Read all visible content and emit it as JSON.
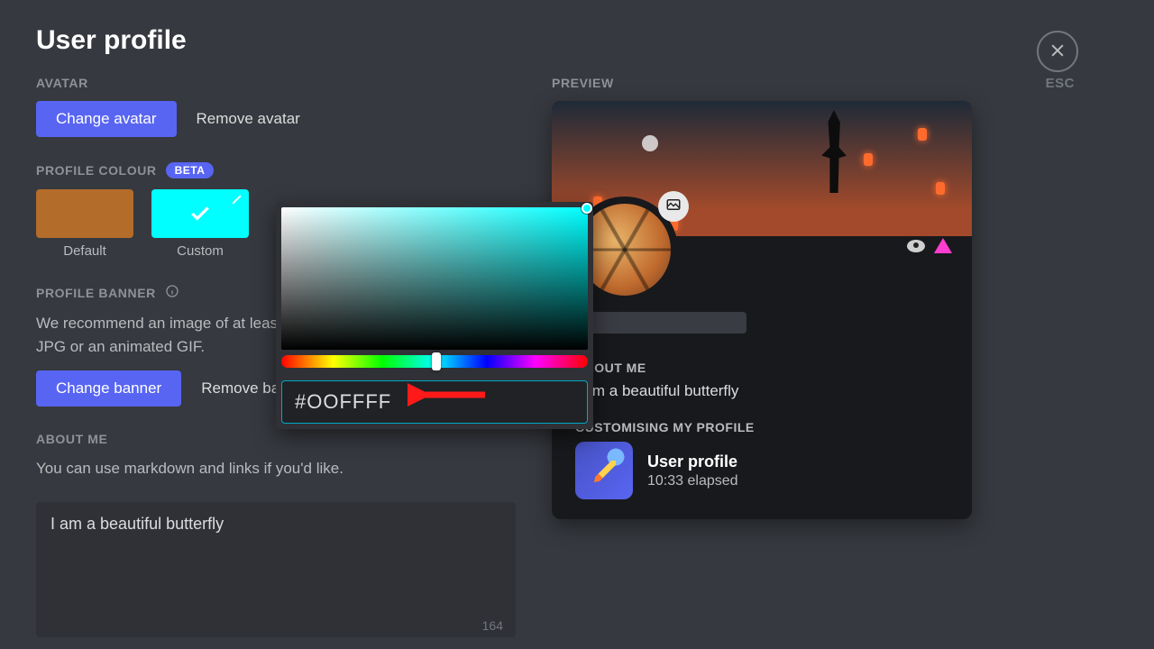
{
  "page": {
    "title": "User profile",
    "close_label": "ESC"
  },
  "avatar": {
    "section_label": "AVATAR",
    "change_label": "Change avatar",
    "remove_label": "Remove avatar"
  },
  "profile_colour": {
    "section_label": "PROFILE COLOUR",
    "beta_label": "BETA",
    "default_label": "Default",
    "custom_label": "Custom",
    "default_hex": "#b46c2a",
    "custom_hex": "#00ffff"
  },
  "banner": {
    "section_label": "PROFILE BANNER",
    "help": "We recommend an image of at least 600×240. You can upload a PNG, JPG or an animated GIF.",
    "change_label": "Change banner",
    "remove_label": "Remove banner"
  },
  "about": {
    "section_label": "ABOUT ME",
    "help": "You can use markdown and links if you'd like.",
    "value": "I am a beautiful butterfly",
    "char_count": "164"
  },
  "picker": {
    "hex_value": "#OOFFFF"
  },
  "preview": {
    "section_label": "PREVIEW",
    "about_label": "ABOUT ME",
    "about_text": "I am a beautiful butterfly",
    "activity_label": "CUSTOMISING MY PROFILE",
    "activity_title": "User profile",
    "activity_sub": "10:33 elapsed"
  }
}
